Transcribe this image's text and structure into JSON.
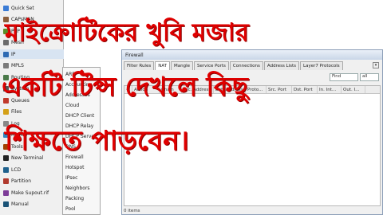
{
  "sidebar": {
    "items": [
      {
        "label": "Quick Set",
        "color": "#3a7bd5"
      },
      {
        "label": "CAPsMAN",
        "color": "#8b5e3c"
      },
      {
        "label": "PPP",
        "color": "#5a8f29"
      },
      {
        "label": "Mesh",
        "color": "#6b6b6b"
      },
      {
        "label": "IP",
        "color": "#2d6ab3",
        "selected": true
      },
      {
        "label": "MPLS",
        "color": "#7a7a7a"
      },
      {
        "label": "Routing",
        "color": "#4a7a4a"
      },
      {
        "label": "System",
        "color": "#555555"
      },
      {
        "label": "Queues",
        "color": "#c0392b"
      },
      {
        "label": "Files",
        "color": "#d4a017"
      },
      {
        "label": "Log",
        "color": "#888888"
      },
      {
        "label": "Radius",
        "color": "#2e86c1"
      },
      {
        "label": "Tools",
        "color": "#a04000"
      },
      {
        "label": "New Terminal",
        "color": "#222222"
      },
      {
        "label": "LCD",
        "color": "#1f618d"
      },
      {
        "label": "Partition",
        "color": "#b03a2e"
      },
      {
        "label": "Make Supout.rif",
        "color": "#7d3c98"
      },
      {
        "label": "Manual",
        "color": "#1a5276"
      }
    ]
  },
  "submenu": {
    "items": [
      {
        "label": "ARP"
      },
      {
        "label": "Accounting"
      },
      {
        "label": "Addresses"
      },
      {
        "label": "Cloud"
      },
      {
        "label": "DHCP Client"
      },
      {
        "label": "DHCP Relay"
      },
      {
        "label": "DHCP Server"
      },
      {
        "label": "DNS"
      },
      {
        "label": "Firewall"
      },
      {
        "label": "Hotspot"
      },
      {
        "label": "IPsec"
      },
      {
        "label": "Neighbors"
      },
      {
        "label": "Packing"
      },
      {
        "label": "Pool"
      }
    ]
  },
  "firewall": {
    "title": "Firewall",
    "tabs": [
      {
        "label": "Filter Rules"
      },
      {
        "label": "NAT",
        "active": true
      },
      {
        "label": "Mangle"
      },
      {
        "label": "Service Ports"
      },
      {
        "label": "Connections"
      },
      {
        "label": "Address Lists"
      },
      {
        "label": "Layer7 Protocols"
      }
    ],
    "find_placeholder": "Find",
    "filter_value": "all",
    "columns": [
      {
        "label": "#"
      },
      {
        "label": "Action"
      },
      {
        "label": "Chain"
      },
      {
        "label": "Src. Address"
      },
      {
        "label": "Dst. Address"
      },
      {
        "label": "Proto..."
      },
      {
        "label": "Src. Port"
      },
      {
        "label": "Dst. Port"
      },
      {
        "label": "In. Int..."
      },
      {
        "label": "Out. I..."
      }
    ],
    "status": "0 items"
  },
  "overlay": {
    "line1": "মাইক্রোটিকের খুবি মজার",
    "line2": "একটি টিপ্স দেখলে কিছু",
    "line3": "শিক্ষতে পাড়বেন।",
    "color": "#e00000"
  }
}
